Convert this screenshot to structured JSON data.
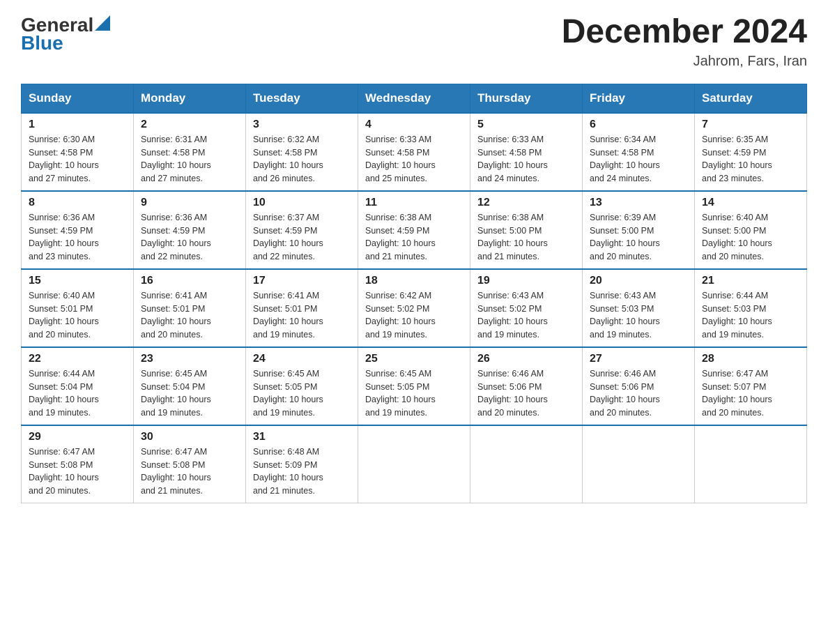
{
  "header": {
    "logo_general": "General",
    "logo_blue": "Blue",
    "month_year": "December 2024",
    "location": "Jahrom, Fars, Iran"
  },
  "weekdays": [
    "Sunday",
    "Monday",
    "Tuesday",
    "Wednesday",
    "Thursday",
    "Friday",
    "Saturday"
  ],
  "weeks": [
    [
      {
        "day": "1",
        "sunrise": "6:30 AM",
        "sunset": "4:58 PM",
        "daylight": "10 hours and 27 minutes."
      },
      {
        "day": "2",
        "sunrise": "6:31 AM",
        "sunset": "4:58 PM",
        "daylight": "10 hours and 27 minutes."
      },
      {
        "day": "3",
        "sunrise": "6:32 AM",
        "sunset": "4:58 PM",
        "daylight": "10 hours and 26 minutes."
      },
      {
        "day": "4",
        "sunrise": "6:33 AM",
        "sunset": "4:58 PM",
        "daylight": "10 hours and 25 minutes."
      },
      {
        "day": "5",
        "sunrise": "6:33 AM",
        "sunset": "4:58 PM",
        "daylight": "10 hours and 24 minutes."
      },
      {
        "day": "6",
        "sunrise": "6:34 AM",
        "sunset": "4:58 PM",
        "daylight": "10 hours and 24 minutes."
      },
      {
        "day": "7",
        "sunrise": "6:35 AM",
        "sunset": "4:59 PM",
        "daylight": "10 hours and 23 minutes."
      }
    ],
    [
      {
        "day": "8",
        "sunrise": "6:36 AM",
        "sunset": "4:59 PM",
        "daylight": "10 hours and 23 minutes."
      },
      {
        "day": "9",
        "sunrise": "6:36 AM",
        "sunset": "4:59 PM",
        "daylight": "10 hours and 22 minutes."
      },
      {
        "day": "10",
        "sunrise": "6:37 AM",
        "sunset": "4:59 PM",
        "daylight": "10 hours and 22 minutes."
      },
      {
        "day": "11",
        "sunrise": "6:38 AM",
        "sunset": "4:59 PM",
        "daylight": "10 hours and 21 minutes."
      },
      {
        "day": "12",
        "sunrise": "6:38 AM",
        "sunset": "5:00 PM",
        "daylight": "10 hours and 21 minutes."
      },
      {
        "day": "13",
        "sunrise": "6:39 AM",
        "sunset": "5:00 PM",
        "daylight": "10 hours and 20 minutes."
      },
      {
        "day": "14",
        "sunrise": "6:40 AM",
        "sunset": "5:00 PM",
        "daylight": "10 hours and 20 minutes."
      }
    ],
    [
      {
        "day": "15",
        "sunrise": "6:40 AM",
        "sunset": "5:01 PM",
        "daylight": "10 hours and 20 minutes."
      },
      {
        "day": "16",
        "sunrise": "6:41 AM",
        "sunset": "5:01 PM",
        "daylight": "10 hours and 20 minutes."
      },
      {
        "day": "17",
        "sunrise": "6:41 AM",
        "sunset": "5:01 PM",
        "daylight": "10 hours and 19 minutes."
      },
      {
        "day": "18",
        "sunrise": "6:42 AM",
        "sunset": "5:02 PM",
        "daylight": "10 hours and 19 minutes."
      },
      {
        "day": "19",
        "sunrise": "6:43 AM",
        "sunset": "5:02 PM",
        "daylight": "10 hours and 19 minutes."
      },
      {
        "day": "20",
        "sunrise": "6:43 AM",
        "sunset": "5:03 PM",
        "daylight": "10 hours and 19 minutes."
      },
      {
        "day": "21",
        "sunrise": "6:44 AM",
        "sunset": "5:03 PM",
        "daylight": "10 hours and 19 minutes."
      }
    ],
    [
      {
        "day": "22",
        "sunrise": "6:44 AM",
        "sunset": "5:04 PM",
        "daylight": "10 hours and 19 minutes."
      },
      {
        "day": "23",
        "sunrise": "6:45 AM",
        "sunset": "5:04 PM",
        "daylight": "10 hours and 19 minutes."
      },
      {
        "day": "24",
        "sunrise": "6:45 AM",
        "sunset": "5:05 PM",
        "daylight": "10 hours and 19 minutes."
      },
      {
        "day": "25",
        "sunrise": "6:45 AM",
        "sunset": "5:05 PM",
        "daylight": "10 hours and 19 minutes."
      },
      {
        "day": "26",
        "sunrise": "6:46 AM",
        "sunset": "5:06 PM",
        "daylight": "10 hours and 20 minutes."
      },
      {
        "day": "27",
        "sunrise": "6:46 AM",
        "sunset": "5:06 PM",
        "daylight": "10 hours and 20 minutes."
      },
      {
        "day": "28",
        "sunrise": "6:47 AM",
        "sunset": "5:07 PM",
        "daylight": "10 hours and 20 minutes."
      }
    ],
    [
      {
        "day": "29",
        "sunrise": "6:47 AM",
        "sunset": "5:08 PM",
        "daylight": "10 hours and 20 minutes."
      },
      {
        "day": "30",
        "sunrise": "6:47 AM",
        "sunset": "5:08 PM",
        "daylight": "10 hours and 21 minutes."
      },
      {
        "day": "31",
        "sunrise": "6:48 AM",
        "sunset": "5:09 PM",
        "daylight": "10 hours and 21 minutes."
      },
      null,
      null,
      null,
      null
    ]
  ],
  "labels": {
    "sunrise": "Sunrise:",
    "sunset": "Sunset:",
    "daylight": "Daylight:"
  }
}
